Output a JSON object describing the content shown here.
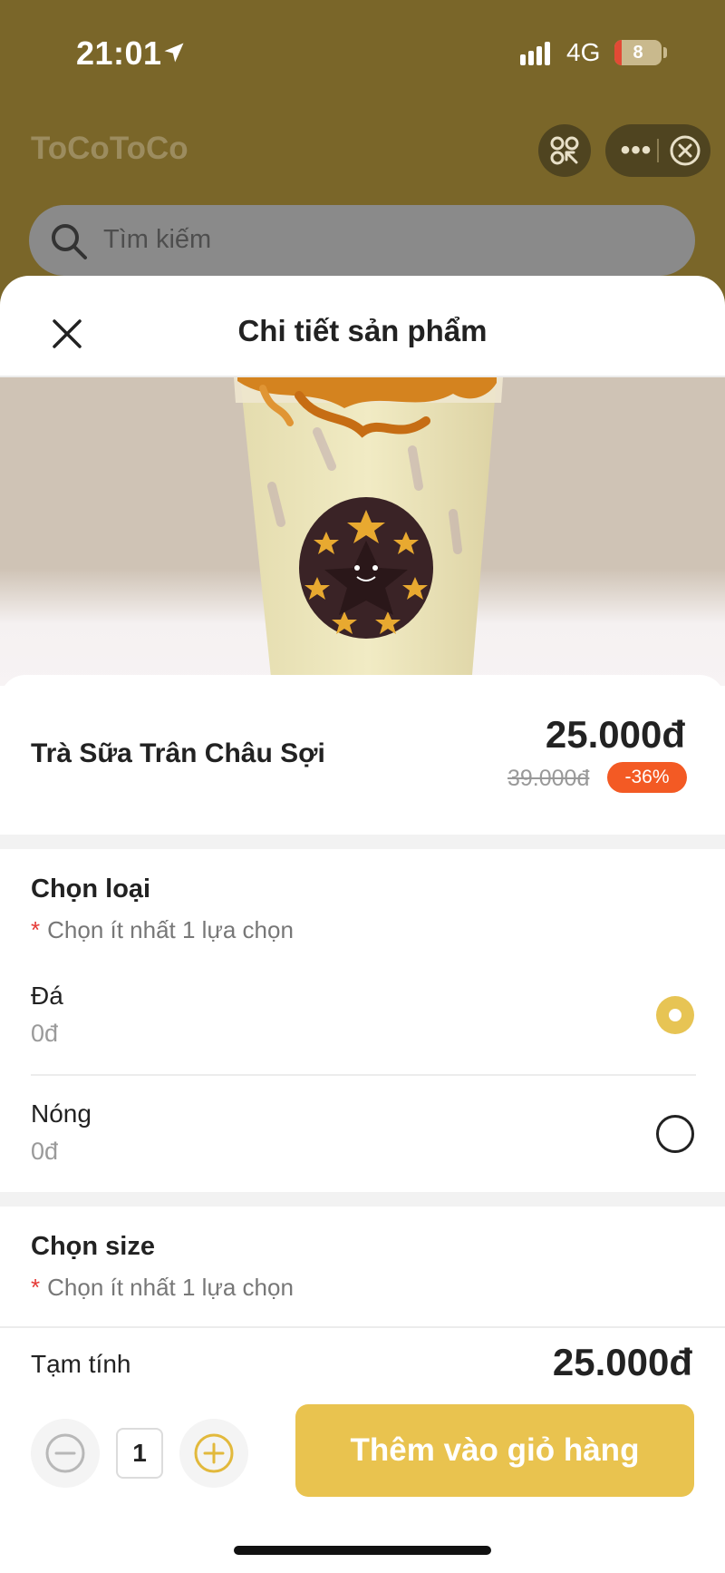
{
  "status_bar": {
    "time": "21:01",
    "network": "4G",
    "battery": "8",
    "battery_level": 0.15
  },
  "app": {
    "title": "ToCoToCo"
  },
  "search": {
    "placeholder": "Tìm kiếm"
  },
  "sheet": {
    "title": "Chi tiết sản phẩm"
  },
  "product": {
    "name": "Trà Sữa Trân Châu Sợi",
    "price": "25.000đ",
    "old_price": "39.000đ",
    "discount": "-36%"
  },
  "type_section": {
    "title": "Chọn loại",
    "required_mark": "*",
    "required_text": "Chọn ít nhất 1 lựa chọn",
    "options": [
      {
        "label": "Đá",
        "price": "0đ",
        "selected": true
      },
      {
        "label": "Nóng",
        "price": "0đ",
        "selected": false
      }
    ]
  },
  "size_section": {
    "title": "Chọn size",
    "required_mark": "*",
    "required_text": "Chọn ít nhất 1 lựa chọn"
  },
  "footer": {
    "subtotal_label": "Tạm tính",
    "subtotal_value": "25.000đ",
    "quantity": "1",
    "add_button": "Thêm vào giỏ hàng"
  },
  "colors": {
    "accent": "#e9c34f",
    "header_bg": "#7a6629",
    "discount_bg": "#f35a24"
  }
}
